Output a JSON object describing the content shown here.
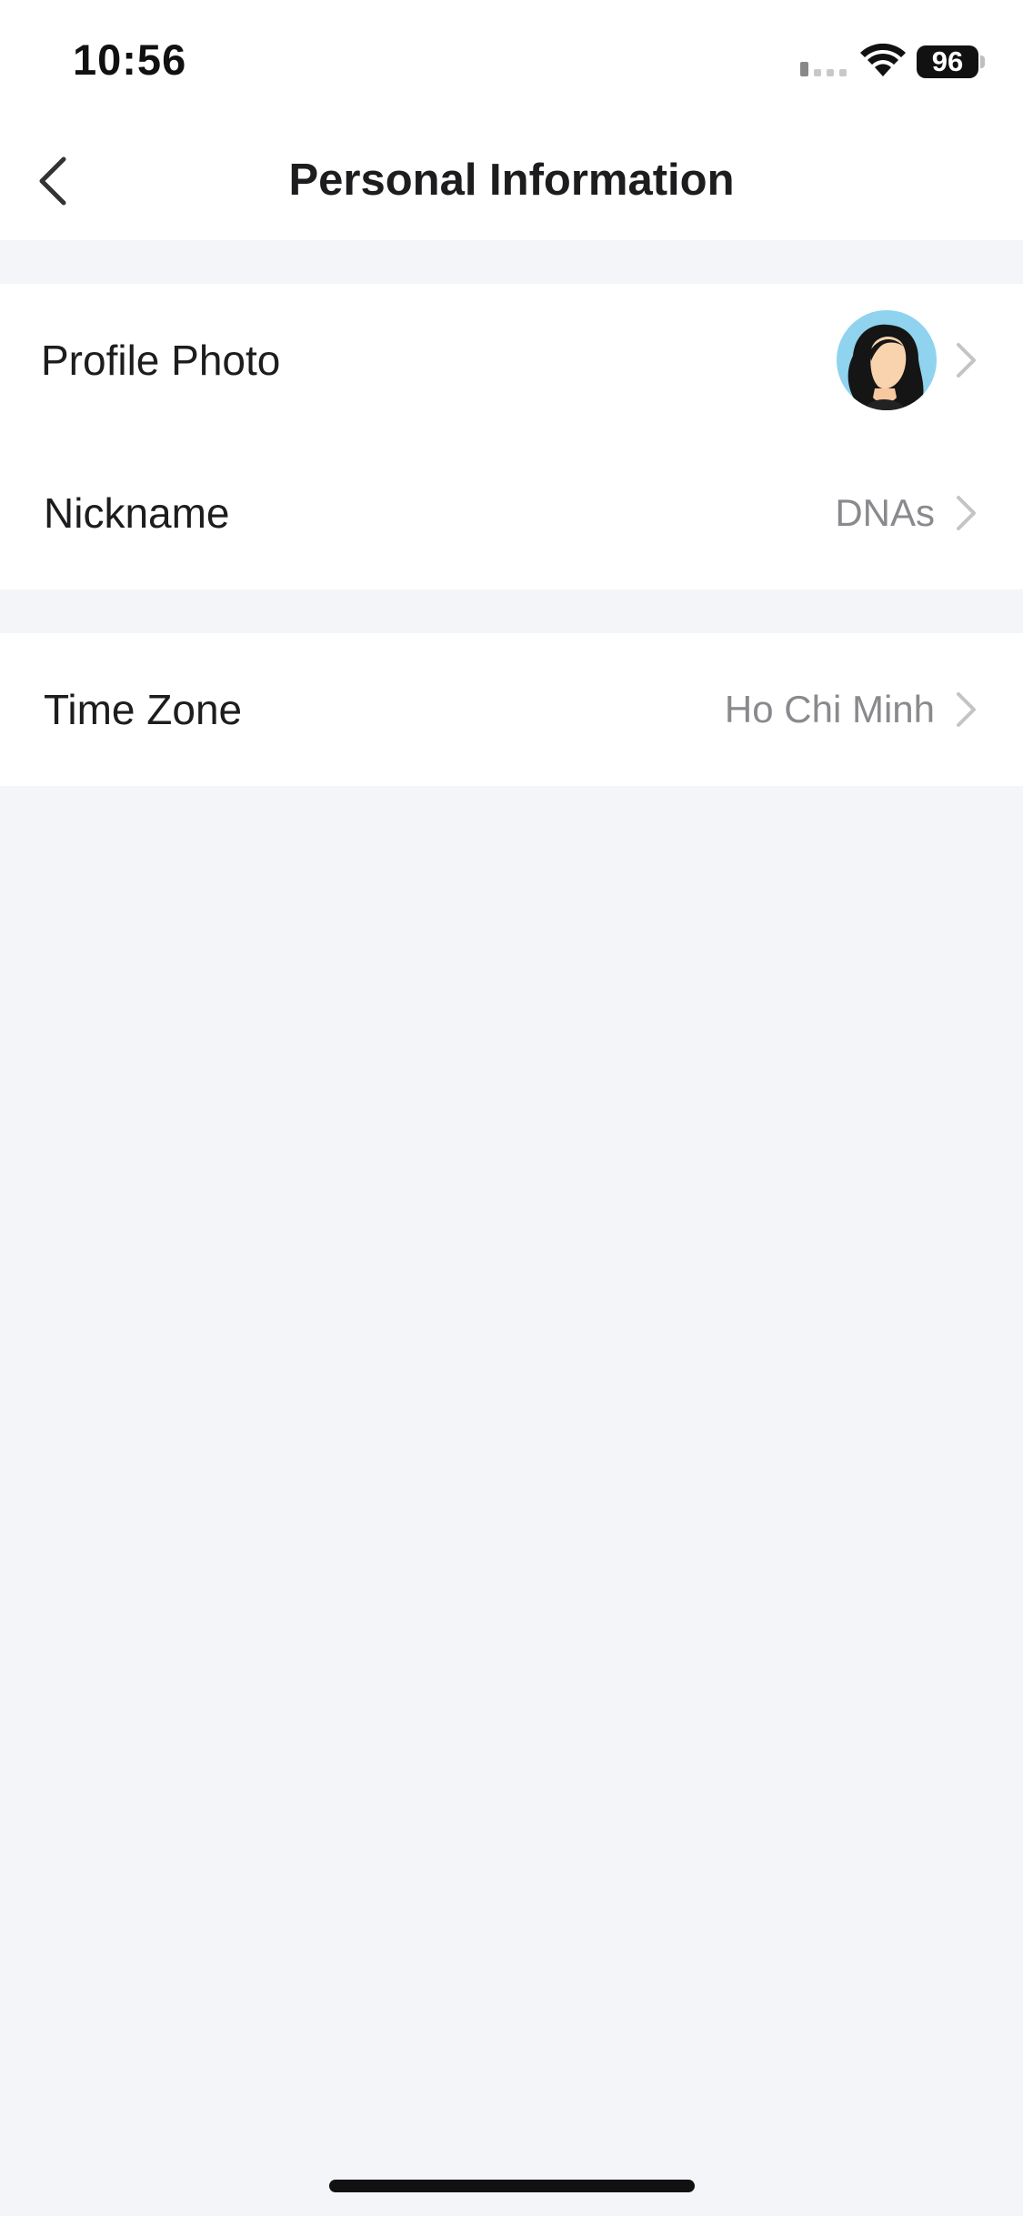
{
  "status_bar": {
    "time": "10:56",
    "battery_level": "96",
    "icons": [
      "signal-icon",
      "wifi-icon",
      "battery-icon"
    ]
  },
  "nav": {
    "title": "Personal Information",
    "back_icon": "chevron-left-icon"
  },
  "rows": {
    "profile_photo": {
      "label": "Profile Photo",
      "icon": "avatar"
    },
    "nickname": {
      "label": "Nickname",
      "value": "DNAs"
    },
    "time_zone": {
      "label": "Time Zone",
      "value": "Ho Chi Minh"
    }
  },
  "colors": {
    "background": "#f4f5f9",
    "card": "#ffffff",
    "text_primary": "#1d1d1f",
    "text_secondary": "#8a8a8e",
    "chevron": "#c4c4c7",
    "avatar_bg": "#8fd3ee"
  }
}
